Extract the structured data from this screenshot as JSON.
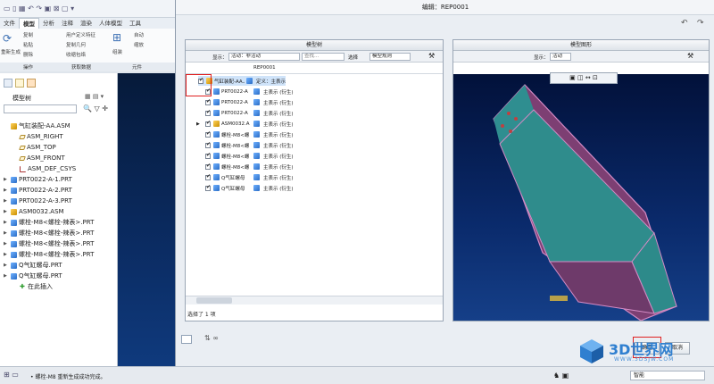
{
  "left_app": {
    "ribbon_tabs": [
      "文件",
      "模型",
      "分析",
      "注释",
      "渲染",
      "人体模型",
      "工具"
    ],
    "active_tab": "模型",
    "ribbon_items": [
      "复制",
      "粘贴",
      "用户定义特征",
      "复制几何",
      "收缩包络",
      "自动",
      "删除",
      "缩放",
      "重新生成",
      "操作",
      "获取数据",
      "元件",
      "组装"
    ],
    "group_labels": [
      "操作",
      "获取数据",
      "元件"
    ],
    "tree_label": "模型树",
    "tree_items": [
      {
        "label": "气缸装配-AA.ASM",
        "icon": "asm-icon",
        "indent": 0,
        "arrow": ""
      },
      {
        "label": "ASM_RIGHT",
        "icon": "plane-icon",
        "indent": 1,
        "arrow": ""
      },
      {
        "label": "ASM_TOP",
        "icon": "plane-icon",
        "indent": 1,
        "arrow": ""
      },
      {
        "label": "ASM_FRONT",
        "icon": "plane-icon",
        "indent": 1,
        "arrow": ""
      },
      {
        "label": "ASM_DEF_CSYS",
        "icon": "csys-icon",
        "indent": 1,
        "arrow": ""
      },
      {
        "label": "PRT0022-A-1.PRT",
        "icon": "part-icon",
        "indent": 0,
        "arrow": "▶"
      },
      {
        "label": "PRT0022-A-2.PRT",
        "icon": "part-icon",
        "indent": 0,
        "arrow": "▶"
      },
      {
        "label": "PRT0022-A-3.PRT",
        "icon": "part-icon",
        "indent": 0,
        "arrow": "▶"
      },
      {
        "label": "ASM0032.ASM",
        "icon": "asm-icon",
        "indent": 0,
        "arrow": "▶"
      },
      {
        "label": "螺栓-M8<螺栓-辣表>.PRT",
        "icon": "part-icon",
        "indent": 0,
        "arrow": "▶"
      },
      {
        "label": "螺栓-M8<螺栓-辣表>.PRT",
        "icon": "part-icon",
        "indent": 0,
        "arrow": "▶"
      },
      {
        "label": "螺栓-M8<螺栓-辣表>.PRT",
        "icon": "part-icon",
        "indent": 0,
        "arrow": "▶"
      },
      {
        "label": "螺栓-M8<螺栓-辣表>.PRT",
        "icon": "part-icon",
        "indent": 0,
        "arrow": "▶"
      },
      {
        "label": "Q气缸螺母.PRT",
        "icon": "part-icon",
        "indent": 0,
        "arrow": "▶"
      },
      {
        "label": "Q气缸螺母.PRT",
        "icon": "part-icon",
        "indent": 0,
        "arrow": "▶"
      },
      {
        "label": "在此插入",
        "icon": "insert-icon",
        "indent": 1,
        "arrow": ""
      }
    ]
  },
  "dialog": {
    "title": "编辑：REP0001",
    "left_panel": {
      "header": "模型树",
      "show_label": "显示：",
      "show_value": "活动：非活动",
      "search_placeholder": "查找...",
      "select_label": "选择",
      "model_rule_label": "模型规则",
      "column_header": "REP0001",
      "rows": [
        {
          "name": "气缸装配-AA.ASM",
          "value": "定义：主表示"
        },
        {
          "name": "PRT0022-A",
          "value": "主表示 (衍生)"
        },
        {
          "name": "PRT0022-A",
          "value": "主表示 (衍生)"
        },
        {
          "name": "PRT0022-A",
          "value": "主表示 (衍生)"
        },
        {
          "name": "ASM0032.A",
          "value": "主表示 (衍生)"
        },
        {
          "name": "螺栓-M8<螺",
          "value": "主表示 (衍生)"
        },
        {
          "name": "螺栓-M8<螺",
          "value": "主表示 (衍生)"
        },
        {
          "name": "螺栓-M8<螺",
          "value": "主表示 (衍生)"
        },
        {
          "name": "螺栓-M8<螺",
          "value": "主表示 (衍生)"
        },
        {
          "name": "Q气缸螺母",
          "value": "主表示 (衍生)"
        },
        {
          "name": "Q气缸螺母",
          "value": "主表示 (衍生)"
        }
      ],
      "status": "选择了 1 项"
    },
    "right_panel": {
      "header": "模型图形",
      "show_label": "显示：",
      "show_value": "活动"
    },
    "ok_label": "确定",
    "cancel_label": "取消"
  },
  "status_bar": {
    "message": "• 螺栓-M8 重新生成成功完成。",
    "filter_value": "智能"
  },
  "watermark": {
    "text": "3D世界网",
    "url": "WWW.3DSJW.COM"
  }
}
